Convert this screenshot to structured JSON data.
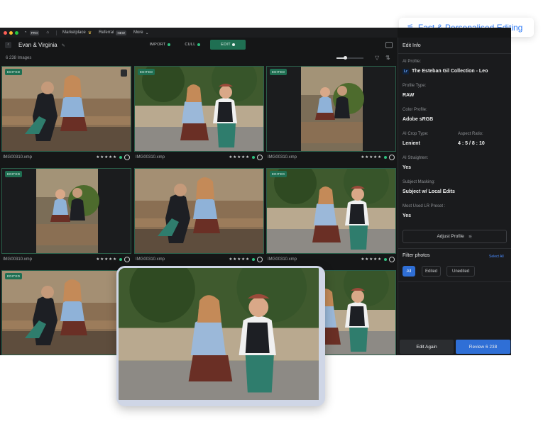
{
  "banner": {
    "text": "Fast & Personalised Editing",
    "icon": "sliders-icon"
  },
  "titlebar": {
    "pro_badge": "PRO",
    "marketplace": "Marketplace",
    "referral": "Referral",
    "referral_badge": "NEW",
    "more": "More"
  },
  "toolbar": {
    "project_title": "Evan & Virginia",
    "tabs": [
      {
        "label": "IMPORT"
      },
      {
        "label": "CULL"
      },
      {
        "label": "EDIT"
      }
    ]
  },
  "grid": {
    "count": "6 238 Images",
    "edited_tag": "EDITED",
    "items": [
      {
        "filename": "IMG00310.xmp",
        "stars": "★★★★★"
      },
      {
        "filename": "IMG00310.xmp",
        "stars": "★★★★★"
      },
      {
        "filename": "IMG00310.xmp",
        "stars": "★★★★★"
      },
      {
        "filename": "IMG00310.xmp",
        "stars": "★★★★★"
      },
      {
        "filename": "IMG00310.xmp",
        "stars": "★★★★★"
      },
      {
        "filename": "IMG00310.xmp",
        "stars": "★★★★★"
      }
    ]
  },
  "side": {
    "title": "Edit Info",
    "ai_profile_label": "AI Profile:",
    "ai_profile_badge": "Lr",
    "ai_profile_value": "The Esteban Gil Collection - Leo",
    "profile_type_label": "Profile Type:",
    "profile_type_value": "RAW",
    "color_profile_label": "Color Profile:",
    "color_profile_value": "Adobe sRGB",
    "crop_type_label": "AI Crop Type:",
    "crop_type_value": "Lenient",
    "aspect_label": "Aspect Ratio:",
    "aspect_value": "4 : 5 / 8 : 10",
    "straighten_label": "AI Straighten:",
    "straighten_value": "Yes",
    "masking_label": "Subject Masking:",
    "masking_value": "Subject w/ Local Edits",
    "preset_label": "Most Used LR Preset :",
    "preset_value": "Yes",
    "adjust_label": "Adjust Profile",
    "filter_title": "Filter photos",
    "select_all": "Select All",
    "chips": [
      "All",
      "Edited",
      "Unedited"
    ],
    "edit_again": "Edit Again",
    "review": "Review 6 238"
  },
  "colors": {
    "accent_green": "#1f6f52",
    "accent_blue": "#2f6fd6",
    "banner_text": "#3b82f6"
  }
}
